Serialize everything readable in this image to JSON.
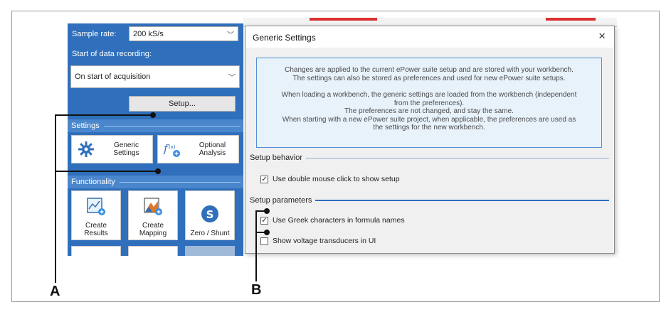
{
  "sample_rate": {
    "label": "Sample rate:",
    "value": "200 kS/s"
  },
  "start_recording": {
    "label": "Start of data recording:",
    "value": "On start of acquisition"
  },
  "setup_button": "Setup...",
  "settings_section": {
    "title": "Settings",
    "generic": "Generic Settings",
    "optional": "Optional Analysis"
  },
  "functionality_section": {
    "title": "Functionality",
    "tiles": [
      "Create Results",
      "Create Mapping",
      "Zero / Shunt"
    ]
  },
  "dialog": {
    "title": "Generic Settings",
    "close": "×",
    "info_lines_1": [
      "Changes are applied to the current ePower suite setup and are stored with your workbench.",
      "The settings can also be stored as preferences and used for new ePower suite setups."
    ],
    "info_lines_2": [
      "When loading a workbench, the generic settings are loaded from the workbench (independent",
      "from the preferences).",
      "The preferences are not changed, and stay the same.",
      "When starting with a new ePower suite project, when applicable, the preferences are used as",
      "the settings for the new workbench."
    ],
    "setup_behavior": {
      "title": "Setup behavior",
      "double_click": {
        "label": "Use double mouse click to show setup",
        "checked": true
      }
    },
    "setup_parameters": {
      "title": "Setup parameters",
      "greek": {
        "label": "Use Greek characters in formula names",
        "checked": true
      },
      "voltage": {
        "label": "Show voltage transducers in UI",
        "checked": false
      }
    }
  },
  "callouts": {
    "a": "A",
    "b": "B"
  },
  "colors": {
    "panel": "#2f6fbb",
    "accent": "#4f8fd8"
  }
}
